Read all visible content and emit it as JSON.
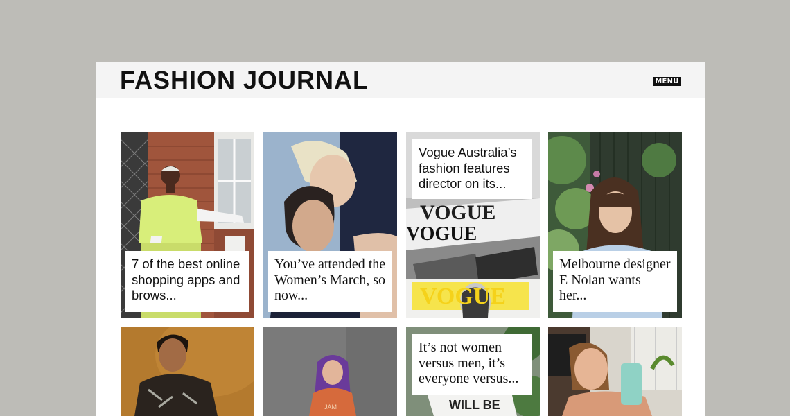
{
  "header": {
    "logo": "FASHION JOURNAL",
    "menu_label": "MENU"
  },
  "articles": [
    {
      "title": "7 of the best online shopping apps and brows..."
    },
    {
      "title": "You’ve attended the Women’s March, so now..."
    },
    {
      "title": "Vogue Australia’s fashion features director on its..."
    },
    {
      "title": "Melbourne designer E Nolan wants her..."
    },
    {
      "title": ""
    },
    {
      "title": ""
    },
    {
      "title": "It’s not women versus men, it’s everyone versus..."
    },
    {
      "title": ""
    }
  ],
  "photo_text": {
    "magazine_masthead": "VOGUE",
    "sign_text": "WILL BE",
    "shirt_text": "JAM"
  },
  "colors": {
    "backdrop": "#bdbcb7",
    "header_bg": "#f4f4f4",
    "page_bg": "#ffffff",
    "text": "#111111"
  }
}
